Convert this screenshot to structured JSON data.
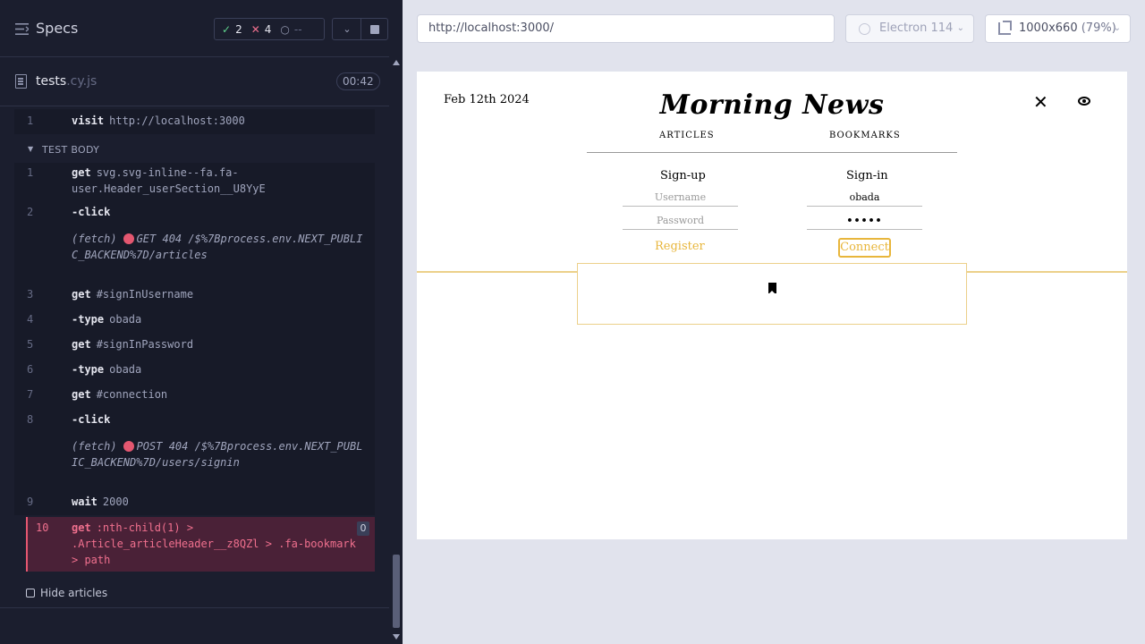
{
  "reporter": {
    "title": "Specs",
    "stats": {
      "passed": "2",
      "failed": "4",
      "pending": "--"
    },
    "file": {
      "name": "tests",
      "ext": ".cy.js",
      "duration": "00:42"
    },
    "test_body_label": "TEST BODY",
    "commands": [
      {
        "num": "1",
        "name": "visit",
        "arg": "http://localhost:3000"
      },
      {
        "num": "1",
        "name": "get",
        "arg": "svg.svg-inline--fa.fa-user.Header_userSection__U8YyE"
      },
      {
        "num": "2",
        "name": "-click",
        "arg": ""
      },
      {
        "fetch": "(fetch)",
        "method": "GET 404",
        "url": "/$%7Bprocess.env.NEXT_PUBLIC_BACKEND%7D/articles"
      },
      {
        "num": "3",
        "name": "get",
        "arg": "#signInUsername"
      },
      {
        "num": "4",
        "name": "-type",
        "arg": "obada"
      },
      {
        "num": "5",
        "name": "get",
        "arg": "#signInPassword"
      },
      {
        "num": "6",
        "name": "-type",
        "arg": "obada"
      },
      {
        "num": "7",
        "name": "get",
        "arg": "#connection"
      },
      {
        "num": "8",
        "name": "-click",
        "arg": ""
      },
      {
        "fetch": "(fetch)",
        "method": "POST 404",
        "url": "/$%7Bprocess.env.NEXT_PUBLIC_BACKEND%7D/users/signin"
      },
      {
        "num": "9",
        "name": "wait",
        "arg": "2000"
      }
    ],
    "failed_command": {
      "num": "10",
      "name": "get",
      "arg": ":nth-child(1) > .Article_articleHeader__z8QZl > .fa-bookmark > path",
      "badge": "0"
    },
    "hide_articles_label": "Hide articles",
    "colors": {
      "fail": "#e45770",
      "pass": "#5fd28c"
    }
  },
  "browser": {
    "url": "http://localhost:3000/",
    "engine": "Electron 114",
    "viewport": "1000x660",
    "zoom": "(79%)"
  },
  "app": {
    "date": "Feb 12th 2024",
    "logo": "Morning News",
    "nav": {
      "articles": "ARTICLES",
      "bookmarks": "BOOKMARKS"
    },
    "close_label": "✕",
    "signup": {
      "title": "Sign-up",
      "username_placeholder": "Username",
      "password_placeholder": "Password",
      "button": "Register"
    },
    "signin": {
      "title": "Sign-in",
      "username_value": "obada",
      "password_value": "•••••",
      "button": "Connect"
    },
    "accent": "#e8b63c"
  }
}
